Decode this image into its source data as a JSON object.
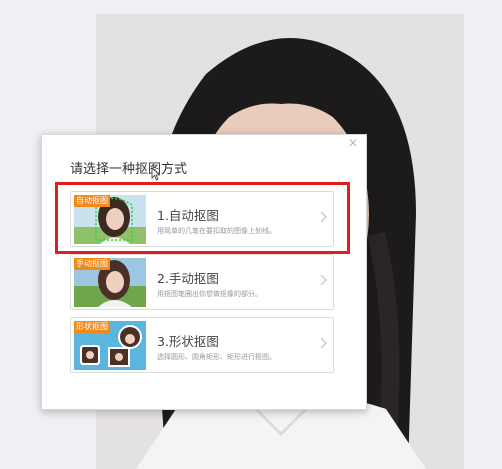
{
  "dialog": {
    "title": "请选择一种抠图方式",
    "close_label": "×",
    "options": [
      {
        "tag": "自动抠图",
        "title": "1.自动抠图",
        "description": "用简单的几笔在要扣取的图像上划线。"
      },
      {
        "tag": "手动抠图",
        "title": "2.手动抠图",
        "description": "用抠图笔圈出你想做抠像的部分。"
      },
      {
        "tag": "形状抠图",
        "title": "3.形状抠图",
        "description": "选择圆形、圆角矩形、矩形进行抠图。"
      }
    ]
  },
  "highlight_color": "#e01e1e",
  "icons": {
    "close": "close-icon",
    "arrow": "chevron-right-icon",
    "cursor": "mouse-cursor-icon"
  }
}
